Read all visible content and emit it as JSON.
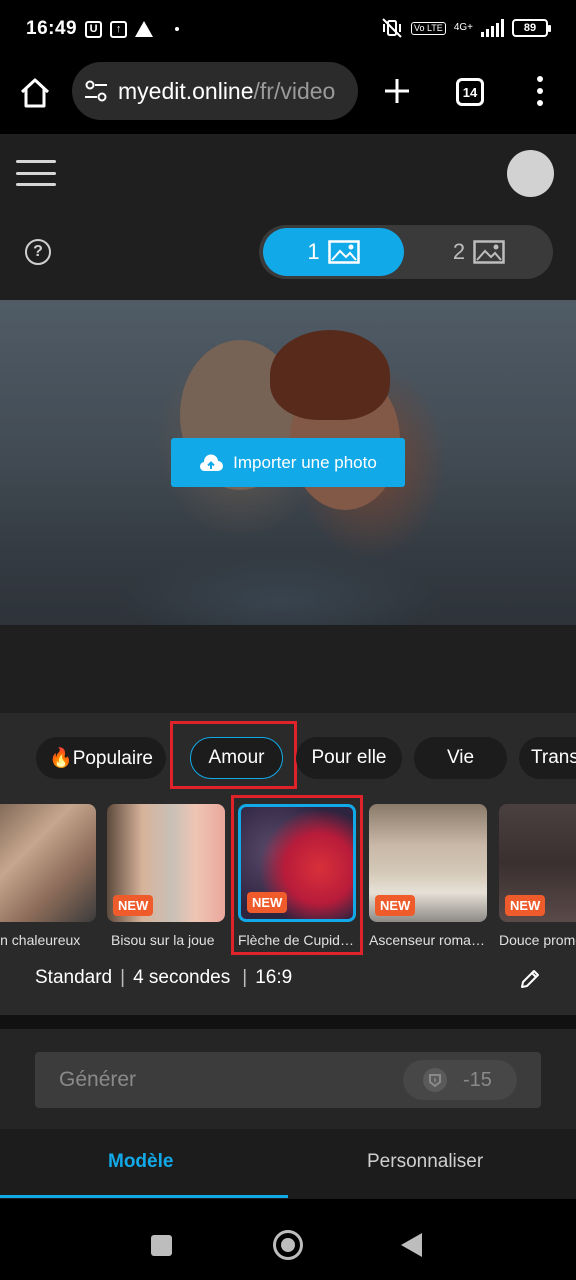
{
  "status_bar": {
    "time": "16:49",
    "icon_u": "U",
    "battery": "89",
    "network": "4G+",
    "volte": "Vo LTE"
  },
  "browser": {
    "url_host": "myedit.online",
    "url_path": "/fr/video",
    "tab_count": "14"
  },
  "image_toggle": {
    "option1": "1",
    "option2": "2"
  },
  "help_label": "?",
  "preview": {
    "import_button": "Importer une photo"
  },
  "categories": [
    {
      "label": "🔥Populaire"
    },
    {
      "label": "Amour"
    },
    {
      "label": "Pour elle"
    },
    {
      "label": "Vie"
    },
    {
      "label": "Trans"
    }
  ],
  "templates": [
    {
      "label": "Câlin chaleureux",
      "badge": ""
    },
    {
      "label": "Bisou sur la joue",
      "badge": "NEW"
    },
    {
      "label": "Flèche de Cupidon",
      "badge": "NEW"
    },
    {
      "label": "Ascenseur romantique",
      "badge": "NEW"
    },
    {
      "label": "Douce promenade",
      "badge": "NEW"
    }
  ],
  "settings": {
    "quality": "Standard",
    "duration": "4 secondes",
    "ratio": "16:9",
    "separator": "|"
  },
  "generate": {
    "label": "Générer",
    "cost": "-15"
  },
  "tabs": {
    "model": "Modèle",
    "customize": "Personnaliser"
  },
  "colors": {
    "accent": "#12a9e8",
    "highlight": "#e0222a",
    "new_badge": "#ef5b2b"
  }
}
